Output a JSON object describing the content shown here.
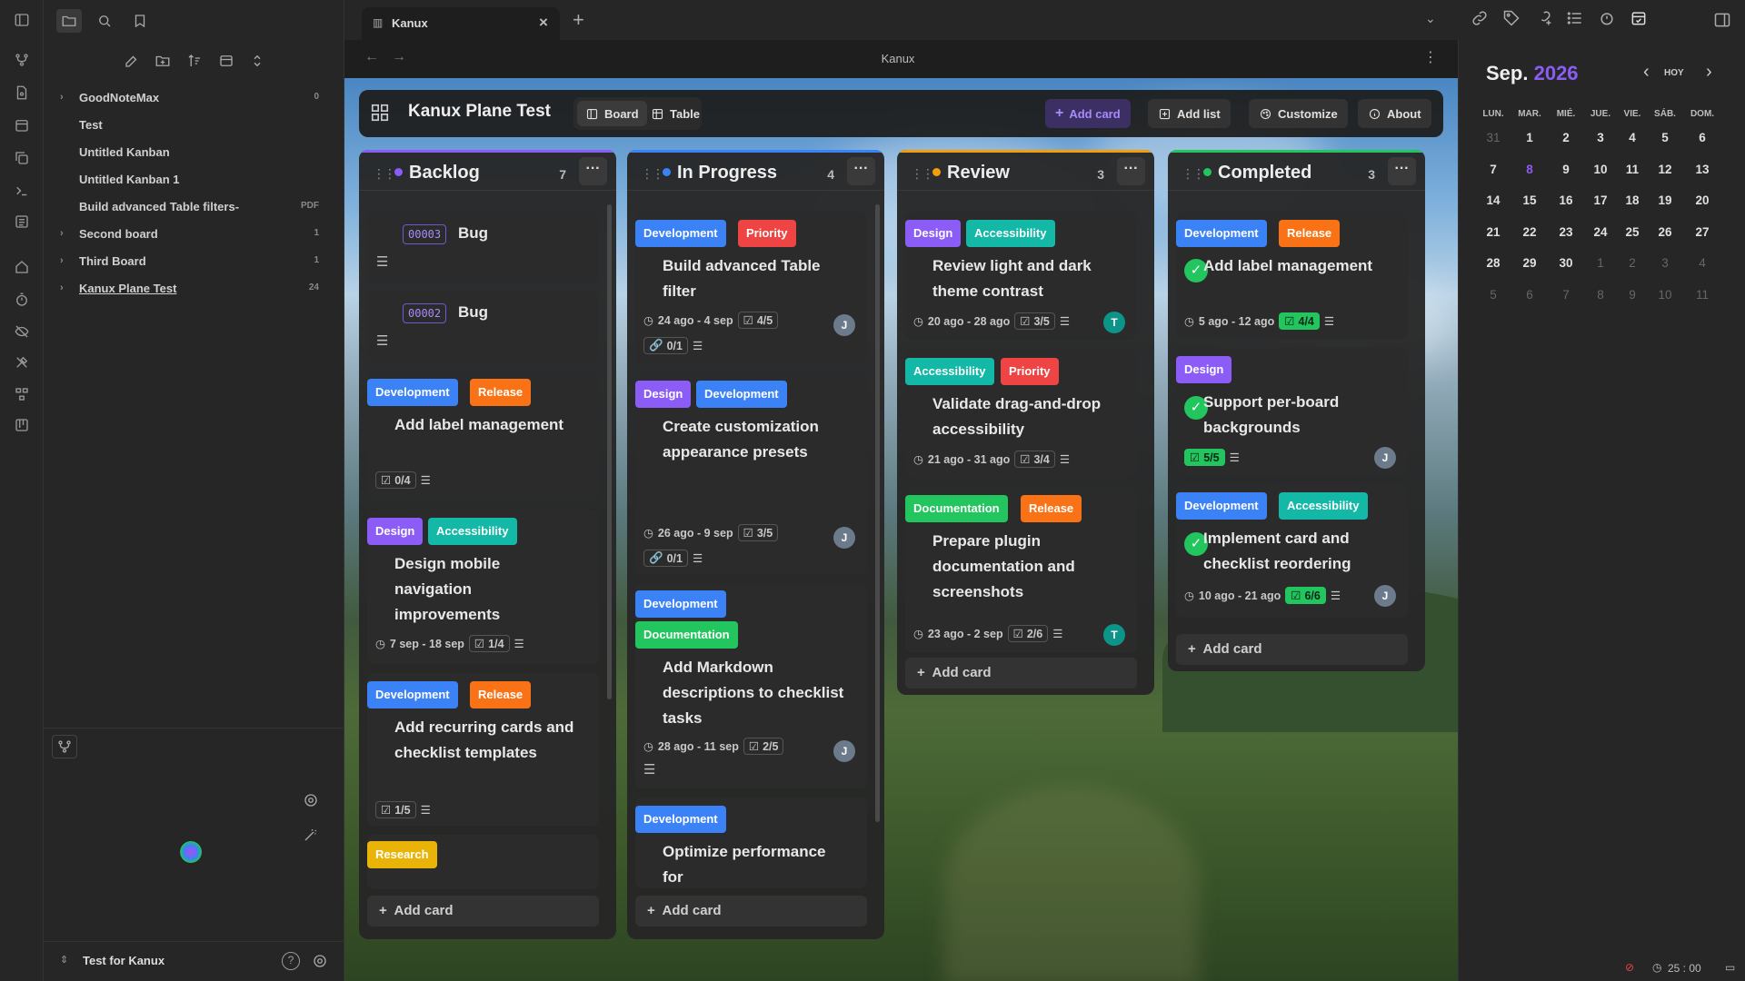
{
  "app": {
    "tab_title": "Kanux",
    "view_title": "Kanux"
  },
  "sidebar": {
    "items": [
      {
        "label": "GoodNoteMax",
        "count": "0",
        "expandable": true
      },
      {
        "label": "Test",
        "count": "",
        "expandable": false
      },
      {
        "label": "Untitled Kanban",
        "count": "",
        "expandable": false
      },
      {
        "label": "Untitled Kanban 1",
        "count": "",
        "expandable": false
      },
      {
        "label": "Build advanced Table filters-",
        "count": "PDF",
        "expandable": false
      },
      {
        "label": "Second board",
        "count": "1",
        "expandable": true
      },
      {
        "label": "Third Board",
        "count": "1",
        "expandable": true
      },
      {
        "label": "Kanux Plane Test",
        "count": "24",
        "expandable": true
      }
    ],
    "vault_name": "Test for Kanux"
  },
  "board": {
    "title": "Kanux Plane Test",
    "view_board": "Board",
    "view_table": "Table",
    "add_card": "Add card",
    "add_list": "Add list",
    "customize": "Customize",
    "about": "About"
  },
  "columns": [
    {
      "title": "Backlog",
      "count": "7",
      "color": "#8b5cf6",
      "add_label": "Add card"
    },
    {
      "title": "In Progress",
      "count": "4",
      "color": "#3b82f6",
      "add_label": "Add card"
    },
    {
      "title": "Review",
      "count": "3",
      "color": "#f59e0b",
      "add_label": "Add card"
    },
    {
      "title": "Completed",
      "count": "3",
      "color": "#22c55e",
      "add_label": "Add card"
    }
  ],
  "cards": {
    "backlog": [
      {
        "number": "00003",
        "title": "Bug"
      },
      {
        "number": "00002",
        "title": "Bug"
      },
      {
        "tags": [
          "Development",
          "Release"
        ],
        "title": "Add label management",
        "checklist": "0/4"
      },
      {
        "tags": [
          "Design",
          "Accessibility"
        ],
        "title": "Design mobile navigation improvements",
        "dates": "7 sep - 18 sep",
        "checklist": "1/4"
      },
      {
        "tags": [
          "Development",
          "Release"
        ],
        "title": "Add recurring cards and checklist templates",
        "checklist": "1/5"
      },
      {
        "tags": [
          "Research"
        ]
      }
    ],
    "inprogress": [
      {
        "tags": [
          "Development",
          "Priority"
        ],
        "title": "Build advanced Table filter",
        "dates": "24 ago - 4 sep",
        "checklist": "4/5",
        "links": "0/1",
        "assignee": "J"
      },
      {
        "tags": [
          "Design",
          "Development"
        ],
        "title": "Create customization appearance presets",
        "dates": "26 ago - 9 sep",
        "checklist": "3/5",
        "links": "0/1",
        "assignee": "J"
      },
      {
        "tags": [
          "Development",
          "Documentation"
        ],
        "title": "Add Markdown descriptions to checklist tasks",
        "dates": "28 ago - 11 sep",
        "checklist": "2/5",
        "assignee": "J"
      },
      {
        "tags": [
          "Development"
        ],
        "title": "Optimize performance for"
      }
    ],
    "review": [
      {
        "tags": [
          "Design",
          "Accessibility"
        ],
        "title": "Review light and dark theme contrast",
        "dates": "20 ago - 28 ago",
        "checklist": "3/5",
        "assignee": "T"
      },
      {
        "tags": [
          "Accessibility",
          "Priority"
        ],
        "title": "Validate drag-and-drop accessibility",
        "dates": "21 ago - 31 ago",
        "checklist": "3/4"
      },
      {
        "tags": [
          "Documentation",
          "Release"
        ],
        "title": "Prepare plugin documentation and screenshots",
        "dates": "23 ago - 2 sep",
        "checklist": "2/6",
        "assignee": "T"
      }
    ],
    "completed": [
      {
        "tags": [
          "Development",
          "Release"
        ],
        "title": "Add label management",
        "dates": "5 ago - 12 ago",
        "checklist": "4/4"
      },
      {
        "tags": [
          "Design"
        ],
        "title": "Support per-board backgrounds",
        "checklist": "5/5",
        "assignee": "J"
      },
      {
        "tags": [
          "Development",
          "Accessibility"
        ],
        "title": "Implement card and checklist reordering",
        "dates": "10 ago - 21 ago",
        "checklist": "6/6",
        "assignee": "J"
      }
    ]
  },
  "calendar": {
    "month": "Sep.",
    "year": "2026",
    "today_label": "HOY",
    "weekdays": [
      "LUN.",
      "MAR.",
      "MIÉ.",
      "JUE.",
      "VIE.",
      "SÁB.",
      "DOM."
    ],
    "weeks": [
      [
        "31",
        "1",
        "2",
        "3",
        "4",
        "5",
        "6"
      ],
      [
        "7",
        "8",
        "9",
        "10",
        "11",
        "12",
        "13"
      ],
      [
        "14",
        "15",
        "16",
        "17",
        "18",
        "19",
        "20"
      ],
      [
        "21",
        "22",
        "23",
        "24",
        "25",
        "26",
        "27"
      ],
      [
        "28",
        "29",
        "30",
        "1",
        "2",
        "3",
        "4"
      ],
      [
        "5",
        "6",
        "7",
        "8",
        "9",
        "10",
        "11"
      ]
    ],
    "today": "8"
  },
  "status": {
    "timer": "25 : 00"
  },
  "colors": {
    "accent": "#8b5cf6",
    "dev": "#3b82f6",
    "release": "#f97316",
    "priority": "#ef4444",
    "design": "#8b5cf6",
    "accessibility": "#14b8a6",
    "documentation": "#22c55e",
    "research": "#eab308"
  }
}
